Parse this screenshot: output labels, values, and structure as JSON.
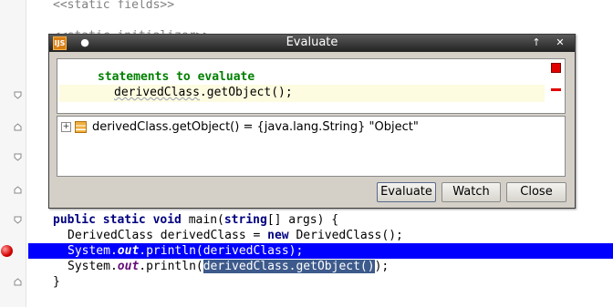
{
  "editor": {
    "line_static_fields": "<<static fields>>",
    "line_static_initializer": "<<static initializer>>",
    "main_signature": {
      "kw1": "public static void",
      "name": " main(",
      "type": "string",
      "rest": "[] args) {"
    },
    "line_decl": {
      "prefix": "DerivedClass derivedClass = ",
      "kw": "new",
      "suffix": " DerivedClass();"
    },
    "line_print1": {
      "prefix": "System.",
      "field": "out",
      "suffix": ".println(derivedClass);"
    },
    "line_print2": {
      "prefix": "System.",
      "field": "out",
      "mid": ".println(",
      "selected": "derivedClass.getObject()",
      "suffix": ");"
    },
    "line_close": "}"
  },
  "dialog": {
    "title": "Evaluate",
    "app_icon_text": "IJS",
    "pin_glyph": "●",
    "maximize_glyph": "↑",
    "close_glyph": "✕",
    "statements_label": "statements to evaluate",
    "statement_text": "derivedClass.getObject();",
    "statement_squiggle": "derivedClass",
    "result_row": "derivedClass.getObject() = {java.lang.String} \"Object\"",
    "expand_glyph": "+",
    "buttons": {
      "evaluate": "Evaluate",
      "watch": "Watch",
      "close": "Close"
    }
  },
  "colors": {
    "breakpoint_line": "#0000ff",
    "selection": "#3d5a8c",
    "keyword": "#000080",
    "label_green": "#008000",
    "error": "#e00000"
  }
}
